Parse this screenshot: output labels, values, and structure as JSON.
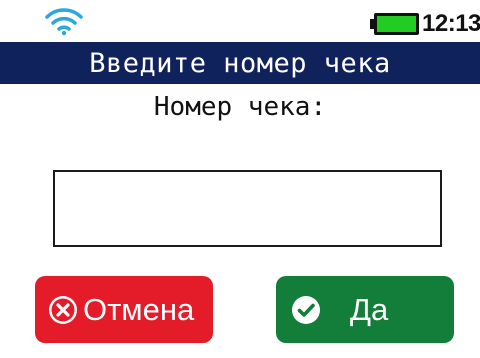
{
  "status": {
    "time": "12:13",
    "wifi_icon": "wifi-icon",
    "battery_icon": "battery-icon",
    "battery_color": "#22cc22"
  },
  "header": {
    "title": "Введите номер чека"
  },
  "form": {
    "prompt": "Номер чека:",
    "input_value": ""
  },
  "buttons": {
    "cancel": {
      "label": "Отмена",
      "icon": "close-circle-icon",
      "color": "#e41c2a"
    },
    "ok": {
      "label": "Да",
      "icon": "check-circle-icon",
      "color": "#137d3a"
    }
  }
}
